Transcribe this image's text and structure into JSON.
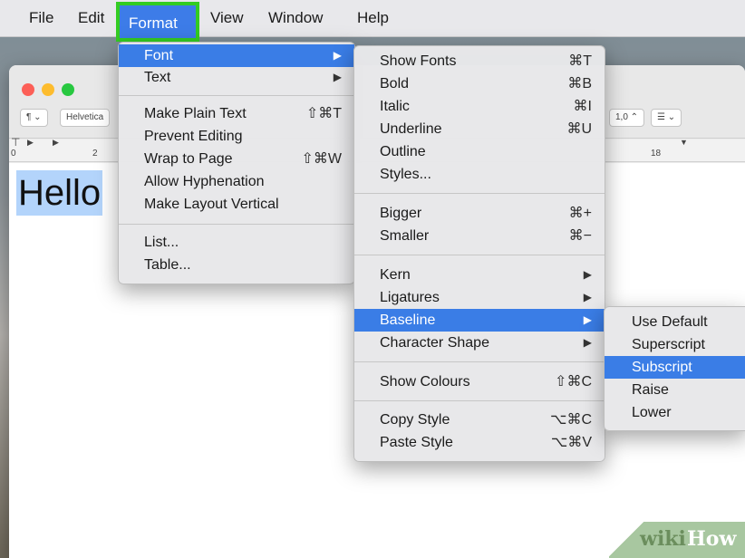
{
  "menubar": {
    "items": [
      "File",
      "Edit",
      "Format",
      "View",
      "Window",
      "Help"
    ]
  },
  "toolbar": {
    "style_label": "¶ ⌄",
    "font_label": "Helvetica",
    "size_label": "1,0 ⌃",
    "list_label": "☰ ⌄"
  },
  "ruler": {
    "ticks": [
      "0",
      "2",
      "18"
    ]
  },
  "document": {
    "text": "Hello"
  },
  "format_menu": {
    "items": [
      {
        "label": "Font",
        "shortcut": "",
        "submenu": true,
        "highlighted": true
      },
      {
        "label": "Text",
        "shortcut": "",
        "submenu": true
      },
      {
        "label": "Make Plain Text",
        "shortcut": "⇧⌘T"
      },
      {
        "label": "Prevent Editing",
        "shortcut": ""
      },
      {
        "label": "Wrap to Page",
        "shortcut": "⇧⌘W"
      },
      {
        "label": "Allow Hyphenation",
        "shortcut": ""
      },
      {
        "label": "Make Layout Vertical",
        "shortcut": ""
      },
      {
        "label": "List...",
        "shortcut": ""
      },
      {
        "label": "Table...",
        "shortcut": ""
      }
    ]
  },
  "font_menu": {
    "items": [
      {
        "label": "Show Fonts",
        "shortcut": "⌘T"
      },
      {
        "label": "Bold",
        "shortcut": "⌘B"
      },
      {
        "label": "Italic",
        "shortcut": "⌘I"
      },
      {
        "label": "Underline",
        "shortcut": "⌘U"
      },
      {
        "label": "Outline",
        "shortcut": ""
      },
      {
        "label": "Styles...",
        "shortcut": ""
      },
      {
        "label": "Bigger",
        "shortcut": "⌘+"
      },
      {
        "label": "Smaller",
        "shortcut": "⌘−"
      },
      {
        "label": "Kern",
        "shortcut": "",
        "submenu": true
      },
      {
        "label": "Ligatures",
        "shortcut": "",
        "submenu": true
      },
      {
        "label": "Baseline",
        "shortcut": "",
        "submenu": true,
        "highlighted": true
      },
      {
        "label": "Character Shape",
        "shortcut": "",
        "submenu": true
      },
      {
        "label": "Show Colours",
        "shortcut": "⇧⌘C"
      },
      {
        "label": "Copy Style",
        "shortcut": "⌥⌘C"
      },
      {
        "label": "Paste Style",
        "shortcut": "⌥⌘V"
      }
    ]
  },
  "baseline_menu": {
    "items": [
      {
        "label": "Use Default"
      },
      {
        "label": "Superscript"
      },
      {
        "label": "Subscript",
        "highlighted": true
      },
      {
        "label": "Raise"
      },
      {
        "label": "Lower"
      }
    ]
  },
  "watermark": {
    "part1": "wiki",
    "part2": "How"
  },
  "colors": {
    "highlight": "#3a7de6",
    "callout": "#33cc22",
    "selection": "#b3d4fb"
  }
}
